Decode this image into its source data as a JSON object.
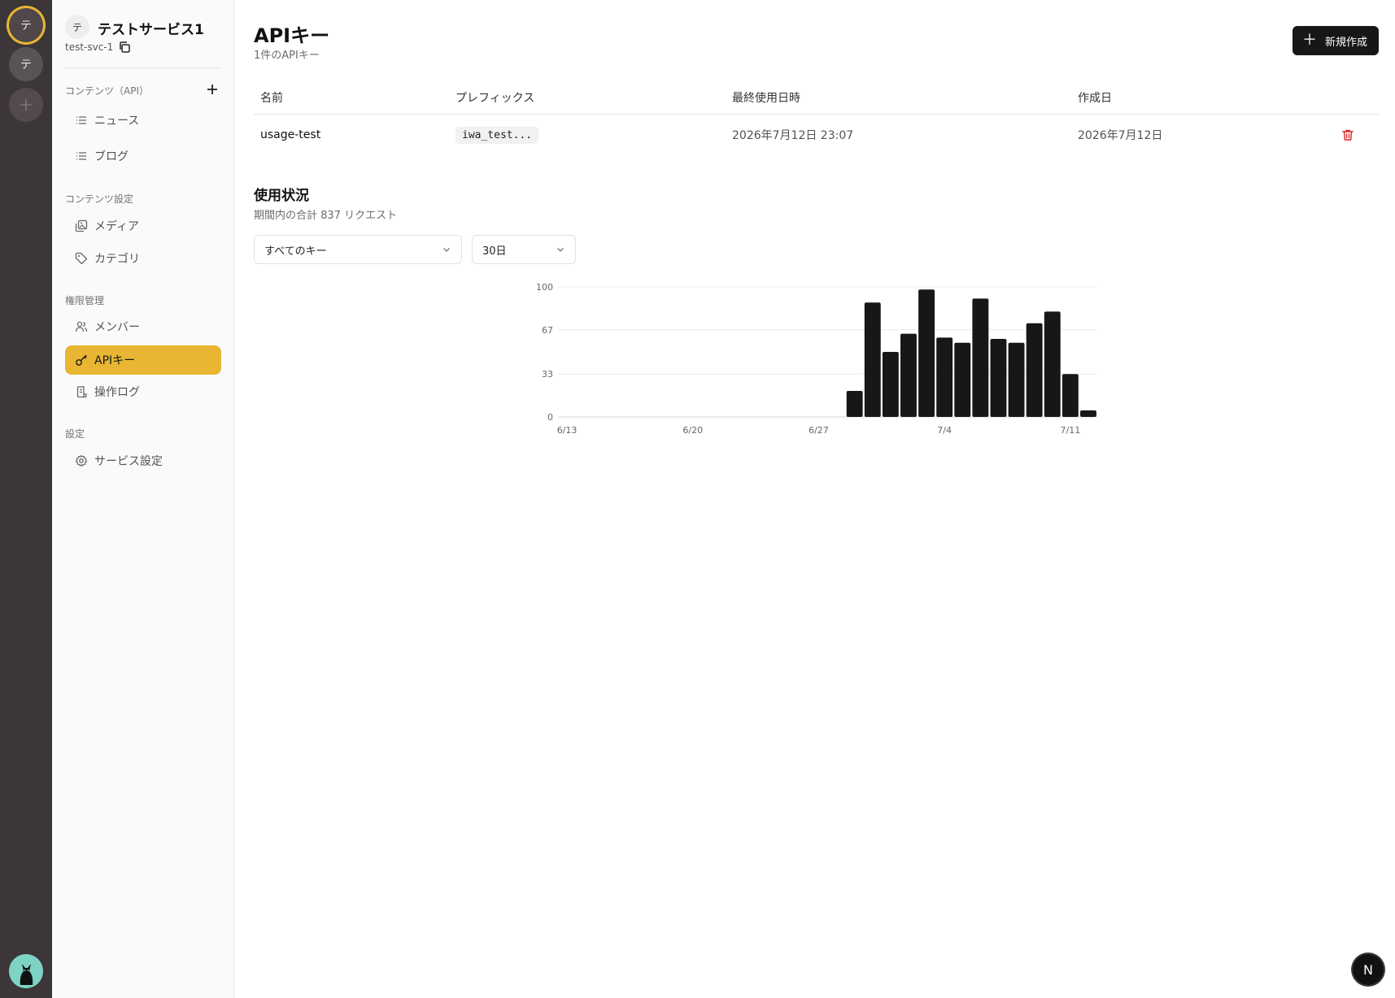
{
  "rail": {
    "services": [
      {
        "initial": "テ",
        "active": true
      },
      {
        "initial": "テ",
        "active": false
      }
    ],
    "add_label": "+"
  },
  "sidebar": {
    "service": {
      "initial": "テ",
      "name": "テストサービス1",
      "slug": "test-svc-1"
    },
    "sections": [
      {
        "label": "コンテンツ（API）",
        "items": [
          {
            "label": "ニュース",
            "icon": "list-icon"
          },
          {
            "label": "ブログ",
            "icon": "list-icon"
          }
        ]
      },
      {
        "label": "コンテンツ設定",
        "items": [
          {
            "label": "メディア",
            "icon": "images-icon"
          },
          {
            "label": "カテゴリ",
            "icon": "tag-icon"
          }
        ]
      },
      {
        "label": "権限管理",
        "items": [
          {
            "label": "メンバー",
            "icon": "users-icon"
          },
          {
            "label": "APIキー",
            "icon": "key-icon",
            "active": true
          },
          {
            "label": "操作ログ",
            "icon": "log-icon"
          }
        ]
      },
      {
        "label": "設定",
        "items": [
          {
            "label": "サービス設定",
            "icon": "gear-icon"
          }
        ]
      }
    ]
  },
  "main": {
    "title": "APIキー",
    "subtitle": "1件のAPIキー",
    "new_button": "新規作成",
    "table": {
      "headers": [
        "名前",
        "プレフィックス",
        "最終使用日時",
        "作成日"
      ],
      "rows": [
        {
          "name": "usage-test",
          "prefix": "iwa_test...",
          "last_used": "2026年7月12日 23:07",
          "created": "2026年7月12日"
        }
      ]
    },
    "usage": {
      "title": "使用状況",
      "subtitle": "期間内の合計 837 リクエスト",
      "key_select": "すべてのキー",
      "range_select": "30日"
    }
  },
  "accent_color": "#e8b632",
  "danger_color": "#dc2626",
  "chart_data": {
    "type": "bar",
    "categories": [
      "6/13",
      "6/14",
      "6/15",
      "6/16",
      "6/17",
      "6/18",
      "6/19",
      "6/20",
      "6/21",
      "6/22",
      "6/23",
      "6/24",
      "6/25",
      "6/26",
      "6/27",
      "6/28",
      "6/29",
      "6/30",
      "7/1",
      "7/2",
      "7/3",
      "7/4",
      "7/5",
      "7/6",
      "7/7",
      "7/8",
      "7/9",
      "7/10",
      "7/11",
      "7/12"
    ],
    "values": [
      0,
      0,
      0,
      0,
      0,
      0,
      0,
      0,
      0,
      0,
      0,
      0,
      0,
      0,
      0,
      0,
      20,
      88,
      50,
      64,
      98,
      61,
      57,
      91,
      60,
      57,
      72,
      81,
      33,
      5
    ],
    "x_tick_labels": [
      "6/13",
      "6/20",
      "6/27",
      "7/4",
      "7/11"
    ],
    "y_ticks": [
      0,
      33,
      67,
      100
    ],
    "ylim": [
      0,
      100
    ],
    "grid": true,
    "bar_color": "#171717"
  }
}
